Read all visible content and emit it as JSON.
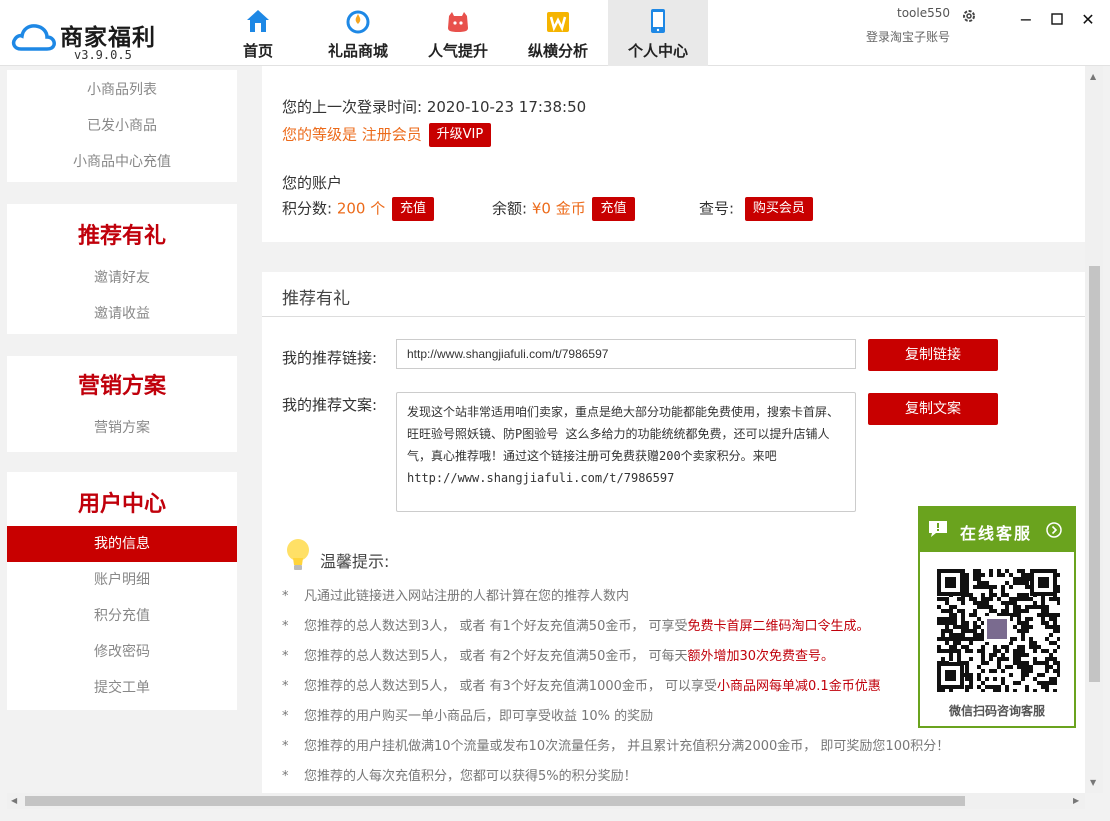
{
  "app": {
    "name": "商家福利",
    "version": "v3.9.0.5"
  },
  "nav": [
    {
      "label": "首页",
      "icon": "home-icon"
    },
    {
      "label": "礼品商城",
      "icon": "gift-store-icon"
    },
    {
      "label": "人气提升",
      "icon": "popularity-icon"
    },
    {
      "label": "纵横分析",
      "icon": "analysis-icon"
    },
    {
      "label": "个人中心",
      "icon": "phone-icon",
      "active": true
    }
  ],
  "user": {
    "name": "toole550",
    "taobao_login": "登录淘宝子账号"
  },
  "sidebar": {
    "top_links": [
      "小商品列表",
      "已发小商品",
      "小商品中心充值"
    ],
    "groups": [
      {
        "title": "推荐有礼",
        "links": [
          "邀请好友",
          "邀请收益"
        ]
      },
      {
        "title": "营销方案",
        "links": [
          "营销方案"
        ]
      },
      {
        "title": "用户中心",
        "links": [
          "我的信息",
          "账户明细",
          "积分充值",
          "修改密码",
          "提交工单"
        ],
        "active": "我的信息"
      }
    ]
  },
  "account": {
    "last_login_label": "您的上一次登录时间:",
    "last_login_value": "2020-10-23 17:38:50",
    "level_label": "您的等级是",
    "level_value": "注册会员",
    "upgrade_btn": "升级VIP",
    "heading": "您的账户",
    "points_label": "积分数:",
    "points_value": "200 个",
    "points_btn": "充值",
    "balance_label": "余额:",
    "balance_value": "¥0 金币",
    "balance_btn": "充值",
    "lookup_label": "查号:",
    "lookup_btn": "购买会员"
  },
  "referral": {
    "title": "推荐有礼",
    "link_label": "我的推荐链接:",
    "link_value": "http://www.shangjiafuli.com/t/7986597",
    "copy_link_btn": "复制链接",
    "text_label": "我的推荐文案:",
    "text_value": "发现这个站非常适用咱们卖家，重点是绝大部分功能都能免费使用，搜索卡首屏、旺旺验号照妖镜、防P图验号 这么多给力的功能统统都免费，还可以提升店铺人气，真心推荐哦！通过这个链接注册可免费获赠200个卖家积分。来吧 http://www.shangjiafuli.com/t/7986597",
    "copy_text_btn": "复制文案"
  },
  "tips": {
    "title": "温馨提示:",
    "star": "*",
    "items": [
      {
        "text": "凡通过此链接进入网站注册的人都计算在您的推荐人数内",
        "highlight": ""
      },
      {
        "text": "您推荐的总人数达到3人，  或者 有1个好友充值满50金币，  可享受",
        "highlight": "免费卡首屏二维码淘口令生成。"
      },
      {
        "text": "您推荐的总人数达到5人，  或者 有2个好友充值满50金币，  可每天",
        "highlight": "额外增加30次免费查号。"
      },
      {
        "text": "您推荐的总人数达到5人，  或者 有3个好友充值满1000金币，  可以享受",
        "highlight": "小商品网每单减0.1金币优惠"
      },
      {
        "text": "您推荐的用户购买一单小商品后，即可享受收益 10% 的奖励",
        "highlight": ""
      },
      {
        "text": "您推荐的用户挂机做满10个流量或发布10次流量任务，  并且累计充值积分满2000金币，  即可奖励您100积分！",
        "highlight": ""
      },
      {
        "text": "您推荐的人每次充值积分，您都可以获得5%的积分奖励！",
        "highlight": ""
      }
    ]
  },
  "customer_service": {
    "title": "在线客服",
    "caption": "微信扫码咨询客服"
  },
  "colors": {
    "brand_red": "#c80000",
    "accent_orange": "#ec6b1b",
    "service_green": "#6aa31e"
  }
}
